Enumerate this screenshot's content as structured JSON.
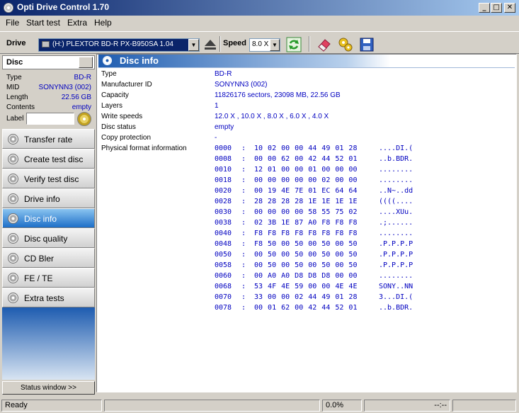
{
  "window": {
    "title": "Opti Drive Control 1.70"
  },
  "menu": [
    {
      "label": "File"
    },
    {
      "label": "Start test"
    },
    {
      "label": "Extra"
    },
    {
      "label": "Help"
    }
  ],
  "toolbar": {
    "drive_label": "Drive",
    "drive_value": "(H:)   PLEXTOR BD-R  PX-B950SA 1.04",
    "speed_label": "Speed",
    "speed_value": "8.0 X"
  },
  "disc": {
    "header": "Disc",
    "props": [
      {
        "key": "Type",
        "value": "BD-R"
      },
      {
        "key": "MID",
        "value": "SONYNN3 (002)"
      },
      {
        "key": "Length",
        "value": "22.56 GB"
      },
      {
        "key": "Contents",
        "value": "empty"
      }
    ],
    "label_caption": "Label"
  },
  "nav": [
    {
      "label": "Transfer rate",
      "active": false
    },
    {
      "label": "Create test disc",
      "active": false
    },
    {
      "label": "Verify test disc",
      "active": false
    },
    {
      "label": "Drive info",
      "active": false
    },
    {
      "label": "Disc info",
      "active": true
    },
    {
      "label": "Disc quality",
      "active": false
    },
    {
      "label": "CD Bler",
      "active": false
    },
    {
      "label": "FE / TE",
      "active": false
    },
    {
      "label": "Extra tests",
      "active": false
    }
  ],
  "status_window_label": "Status window >>",
  "content": {
    "title": "Disc info",
    "rows": [
      {
        "key": "Type",
        "value": "BD-R"
      },
      {
        "key": "Manufacturer ID",
        "value": "SONYNN3 (002)"
      },
      {
        "key": "Capacity",
        "value": "11826176 sectors, 23098 MB, 22.56 GB"
      },
      {
        "key": "Layers",
        "value": "1"
      },
      {
        "key": "Write speeds",
        "value": "12.0 X , 10.0 X , 8.0 X , 6.0 X , 4.0 X"
      },
      {
        "key": "Disc status",
        "value": "empty"
      },
      {
        "key": "Copy protection",
        "value": "-"
      },
      {
        "key": "Physical format information",
        "value": ""
      }
    ],
    "hex": [
      {
        "addr": "0000",
        "bytes": "10 02 00 00 44 49 01 28",
        "ascii": "....DI.("
      },
      {
        "addr": "0008",
        "bytes": "00 00 62 00 42 44 52 01",
        "ascii": "..b.BDR."
      },
      {
        "addr": "0010",
        "bytes": "12 01 00 00 01 00 00 00",
        "ascii": "........"
      },
      {
        "addr": "0018",
        "bytes": "00 00 00 00 00 02 00 00",
        "ascii": "........"
      },
      {
        "addr": "0020",
        "bytes": "00 19 4E 7E 01 EC 64 64",
        "ascii": "..N~..dd"
      },
      {
        "addr": "0028",
        "bytes": "28 28 28 28 1E 1E 1E 1E",
        "ascii": "((((...."
      },
      {
        "addr": "0030",
        "bytes": "00 00 00 00 58 55 75 02",
        "ascii": "....XUu."
      },
      {
        "addr": "0038",
        "bytes": "02 3B 1E 87 A0 F8 F8 F8",
        "ascii": ".;......"
      },
      {
        "addr": "0040",
        "bytes": "F8 F8 F8 F8 F8 F8 F8 F8",
        "ascii": "........"
      },
      {
        "addr": "0048",
        "bytes": "F8 50 00 50 00 50 00 50",
        "ascii": ".P.P.P.P"
      },
      {
        "addr": "0050",
        "bytes": "00 50 00 50 00 50 00 50",
        "ascii": ".P.P.P.P"
      },
      {
        "addr": "0058",
        "bytes": "00 50 00 50 00 50 00 50",
        "ascii": ".P.P.P.P"
      },
      {
        "addr": "0060",
        "bytes": "00 A0 A0 D8 D8 D8 00 00",
        "ascii": "........"
      },
      {
        "addr": "0068",
        "bytes": "53 4F 4E 59 00 00 4E 4E",
        "ascii": "SONY..NN"
      },
      {
        "addr": "0070",
        "bytes": "33 00 00 02 44 49 01 28",
        "ascii": "3...DI.("
      },
      {
        "addr": "0078",
        "bytes": "00 01 62 00 42 44 52 01",
        "ascii": "..b.BDR."
      }
    ]
  },
  "statusbar": {
    "status": "Ready",
    "progress": "0.0%",
    "time": "--:--"
  }
}
